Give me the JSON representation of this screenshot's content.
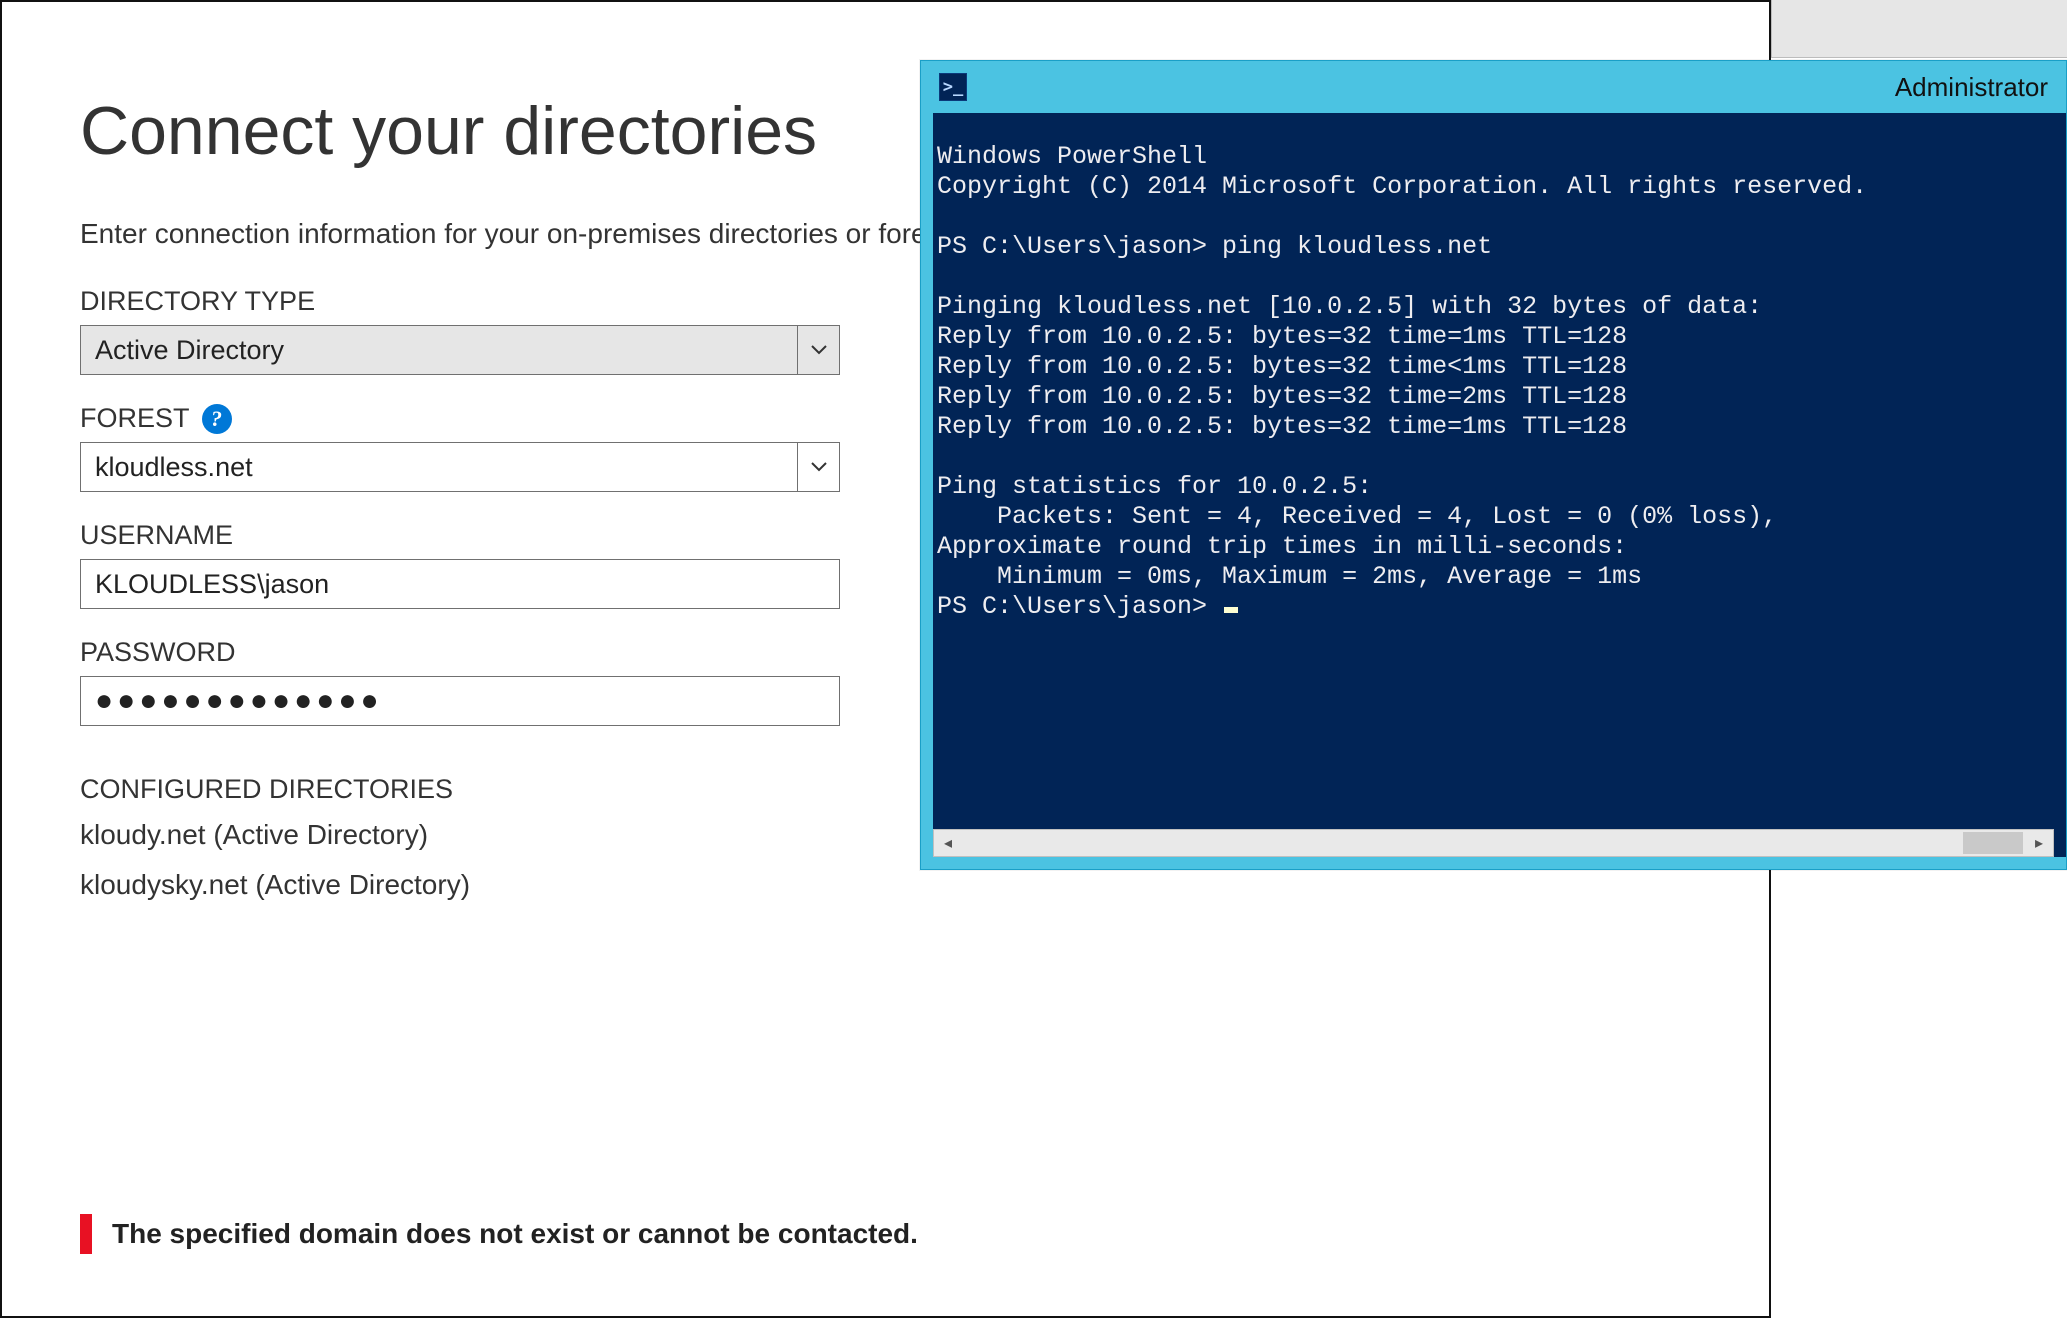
{
  "page": {
    "title": "Connect your directories",
    "subtitle": "Enter connection information for your on-premises directories or forests."
  },
  "form": {
    "directory_type_label": "DIRECTORY TYPE",
    "directory_type_value": "Active Directory",
    "forest_label": "FOREST",
    "forest_value": "kloudless.net",
    "username_label": "USERNAME",
    "username_value": "KLOUDLESS\\jason",
    "password_label": "PASSWORD",
    "password_masked": "●●●●●●●●●●●●●",
    "configured_label": "CONFIGURED DIRECTORIES",
    "configured_items": [
      "kloudy.net (Active Directory)",
      "kloudysky.net (Active Directory)"
    ]
  },
  "error": {
    "message": "The specified domain does not exist or cannot be contacted."
  },
  "powershell": {
    "title": "Administrator",
    "icon_glyph": ">_",
    "lines": [
      "Windows PowerShell",
      "Copyright (C) 2014 Microsoft Corporation. All rights reserved.",
      "",
      "PS C:\\Users\\jason> ping kloudless.net",
      "",
      "Pinging kloudless.net [10.0.2.5] with 32 bytes of data:",
      "Reply from 10.0.2.5: bytes=32 time=1ms TTL=128",
      "Reply from 10.0.2.5: bytes=32 time<1ms TTL=128",
      "Reply from 10.0.2.5: bytes=32 time=2ms TTL=128",
      "Reply from 10.0.2.5: bytes=32 time=1ms TTL=128",
      "",
      "Ping statistics for 10.0.2.5:",
      "    Packets: Sent = 4, Received = 4, Lost = 0 (0% loss),",
      "Approximate round trip times in milli-seconds:",
      "    Minimum = 0ms, Maximum = 2ms, Average = 1ms",
      "PS C:\\Users\\jason> "
    ]
  }
}
